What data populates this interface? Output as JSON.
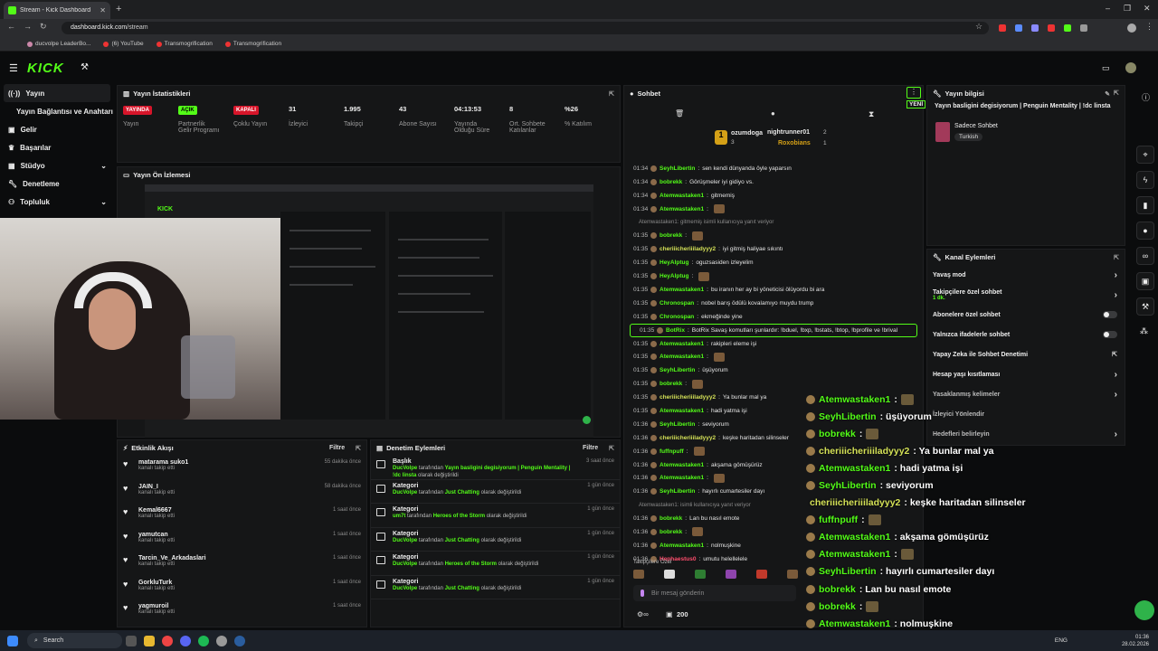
{
  "browser": {
    "tab_title": "Stream - Kick Dashboard",
    "url_host": "dashboard.kick.com",
    "url_path": "/stream",
    "bookmarks": [
      "ducvolpe LeaderBo...",
      "(6) YouTube",
      "Transmogrification",
      "Transmogrification"
    ]
  },
  "app": {
    "logo": "KICK"
  },
  "sidebar": {
    "items": [
      {
        "label": "Yayın",
        "icon": "broadcast-icon"
      },
      {
        "label": "Yayın Bağlantısı ve Anahtarı",
        "icon": ""
      },
      {
        "label": "Gelir",
        "icon": "wallet-icon"
      },
      {
        "label": "Başarılar",
        "icon": "trophy-icon"
      },
      {
        "label": "Stüdyo",
        "icon": "studio-icon"
      },
      {
        "label": "Denetleme",
        "icon": "wrench-icon"
      },
      {
        "label": "Topluluk",
        "icon": "people-icon"
      }
    ]
  },
  "stats_panel": {
    "title": "Yayın İstatistikleri",
    "items": [
      {
        "value": "YAYINDA",
        "label": "Yayın",
        "badge": "red"
      },
      {
        "value": "AÇIK",
        "label": "Partnerlik Gelir Programı",
        "badge": "green"
      },
      {
        "value": "KAPALI",
        "label": "Çoklu Yayın",
        "badge": "red"
      },
      {
        "value": "31",
        "label": "İzleyici"
      },
      {
        "value": "1.995",
        "label": "Takipçi"
      },
      {
        "value": "43",
        "label": "Abone Sayısı"
      },
      {
        "value": "04:13:53",
        "label": "Yayında Olduğu Süre"
      },
      {
        "value": "8",
        "label": "Ort. Sohbete Katılanlar"
      },
      {
        "value": "%26",
        "label": "% Katılım"
      }
    ]
  },
  "preview_panel": {
    "title": "Yayın Ön İzlemesi"
  },
  "activity_panel": {
    "title": "Etkinlik Akışı",
    "filter": "Filtre",
    "items": [
      {
        "name": "matarama suko1",
        "action": "kanalı takip etti",
        "time": "55 dakika önce"
      },
      {
        "name": "JAIN_I",
        "action": "kanalı takip etti",
        "time": "58 dakika önce"
      },
      {
        "name": "Kemal6667",
        "action": "kanalı takip etti",
        "time": "1 saat önce"
      },
      {
        "name": "yamutcan",
        "action": "kanalı takip etti",
        "time": "1 saat önce"
      },
      {
        "name": "Tarcin_Ve_Arkadaslari",
        "action": "kanalı takip etti",
        "time": "1 saat önce"
      },
      {
        "name": "GorkluTurk",
        "action": "kanalı takip etti",
        "time": "1 saat önce"
      },
      {
        "name": "yagmuroil",
        "action": "kanalı takip etti",
        "time": "1 saat önce"
      }
    ]
  },
  "moderation_panel": {
    "title": "Denetim Eylemleri",
    "filter": "Filtre",
    "items": [
      {
        "title": "Başlık",
        "user": "DucVolpe",
        "mid": " tarafından ",
        "target": "Yayın basligini degisiyorum | Penguin Mentality | !dc linsta",
        "suffix": " olarak değiştirildi",
        "time": "3 saat önce"
      },
      {
        "title": "Kategori",
        "user": "DucVolpe",
        "mid": " tarafından ",
        "target": "Just Chatting",
        "suffix": " olarak değiştirildi",
        "time": "1 gün önce"
      },
      {
        "title": "Kategori",
        "user": "um7t",
        "mid": " tarafından ",
        "target": "Heroes of the Storm",
        "suffix": " olarak değiştirildi",
        "time": "1 gün önce"
      },
      {
        "title": "Kategori",
        "user": "DucVolpe",
        "mid": " tarafından ",
        "target": "Just Chatting",
        "suffix": " olarak değiştirildi",
        "time": "1 gün önce"
      },
      {
        "title": "Kategori",
        "user": "DucVolpe",
        "mid": " tarafından ",
        "target": "Heroes of the Storm",
        "suffix": " olarak değiştirildi",
        "time": "1 gün önce"
      },
      {
        "title": "Kategori",
        "user": "DucVolpe",
        "mid": " tarafından ",
        "target": "Just Chatting",
        "suffix": " olarak değiştirildi",
        "time": "1 gün önce"
      }
    ]
  },
  "chat_panel": {
    "title": "Sohbet",
    "new_label": "YENİ",
    "leaders": [
      {
        "name": "ozumdoga",
        "count": "3"
      },
      {
        "name": "nightrunner01",
        "count": "2"
      },
      {
        "name": "Roxobians",
        "count": "1"
      }
    ],
    "messages": [
      {
        "time": "01:34",
        "user": "SeyhLibertin",
        "color": "#53fc18",
        "text": "sen kendi dünyanda öyle yaparsın"
      },
      {
        "time": "01:34",
        "user": "bobrekk",
        "color": "#53fc18",
        "text": "Görüşmeler iyi gidiyo vs."
      },
      {
        "time": "01:34",
        "user": "Atemwastaken1",
        "color": "#53fc18",
        "text": "gitmemiş"
      },
      {
        "time": "01:34",
        "user": "Atemwastaken1",
        "color": "#53fc18",
        "text": ""
      },
      {
        "time": "",
        "user": "",
        "color": "#888",
        "text": "Atemwastaken1: gitmemiş isimli kullanıcıya yanıt veriyor",
        "system": true
      },
      {
        "time": "01:35",
        "user": "bobrekk",
        "color": "#53fc18",
        "text": ""
      },
      {
        "time": "01:35",
        "user": "cheriiicheriiiladyyy2",
        "color": "#d4e157",
        "text": "iyi gitmiş haliyae sıkıntı"
      },
      {
        "time": "01:35",
        "user": "HeyAlptug",
        "color": "#53fc18",
        "text": "oguzsasiden izleyelim"
      },
      {
        "time": "01:35",
        "user": "HeyAlptug",
        "color": "#53fc18",
        "text": ""
      },
      {
        "time": "01:35",
        "user": "Atemwastaken1",
        "color": "#53fc18",
        "text": "bu iranın her ay bi yöneticisi ölüyordu bi ara"
      },
      {
        "time": "01:35",
        "user": "Chronospan",
        "color": "#53fc18",
        "text": "nobel barış ödülü kovalamıyo muydu trump"
      },
      {
        "time": "01:35",
        "user": "Chronospan",
        "color": "#53fc18",
        "text": "ekmeğinde yine"
      },
      {
        "time": "01:35",
        "user": "BotRix",
        "color": "#53fc18",
        "text": "BotRix Savaş komutları şunlardır: !bduel, !bxp, !bstats, !btop, !bprofile ve !brival",
        "highlight": true
      },
      {
        "time": "01:35",
        "user": "Atemwastaken1",
        "color": "#53fc18",
        "text": "rakipleri eleme işi"
      },
      {
        "time": "01:35",
        "user": "Atemwastaken1",
        "color": "#53fc18",
        "text": ""
      },
      {
        "time": "01:35",
        "user": "SeyhLibertin",
        "color": "#53fc18",
        "text": "üşüyorum"
      },
      {
        "time": "01:35",
        "user": "bobrekk",
        "color": "#53fc18",
        "text": ""
      },
      {
        "time": "01:35",
        "user": "cheriiicheriiiladyyy2",
        "color": "#d4e157",
        "text": "Ya bunlar mal ya"
      },
      {
        "time": "01:35",
        "user": "Atemwastaken1",
        "color": "#53fc18",
        "text": "hadi yatma işi"
      },
      {
        "time": "01:36",
        "user": "SeyhLibertin",
        "color": "#53fc18",
        "text": "seviyorum"
      },
      {
        "time": "01:36",
        "user": "cheriiicheriiiladyyy2",
        "color": "#d4e157",
        "text": "keşke haritadan silinseler"
      },
      {
        "time": "01:36",
        "user": "fuffnpuff",
        "color": "#53fc18",
        "text": ""
      },
      {
        "time": "01:36",
        "user": "Atemwastaken1",
        "color": "#53fc18",
        "text": "akşama gömüşürüz"
      },
      {
        "time": "01:36",
        "user": "Atemwastaken1",
        "color": "#53fc18",
        "text": ""
      },
      {
        "time": "01:36",
        "user": "SeyhLibertin",
        "color": "#53fc18",
        "text": "hayırlı cumartesiler dayı"
      },
      {
        "time": "",
        "user": "",
        "color": "#888",
        "text": "Atemwastaken1: isimli kullanıcıya yanıt veriyor",
        "system": true
      },
      {
        "time": "01:36",
        "user": "bobrekk",
        "color": "#53fc18",
        "text": "Lan bu nasıl emote"
      },
      {
        "time": "01:36",
        "user": "bobrekk",
        "color": "#53fc18",
        "text": ""
      },
      {
        "time": "01:36",
        "user": "Atemwastaken1",
        "color": "#53fc18",
        "text": "nolmuşkine"
      },
      {
        "time": "01:36",
        "user": "Hephaestus0",
        "color": "#ff4d6d",
        "text": "umutu helellelele"
      }
    ],
    "follower_label": "Takipçilere Özel",
    "input_placeholder": "Bir mesaj gönderin",
    "points": "200"
  },
  "stream_info_panel": {
    "title": "Yayın bilgisi",
    "stream_title": "Yayın basligini degisiyorum | Penguin Mentality | !dc linsta",
    "category": "Sadece Sohbet",
    "tag": "Turkish"
  },
  "channel_actions_panel": {
    "title": "Kanal Eylemleri",
    "items": [
      {
        "label": "Yavaş mod",
        "control": "arrow"
      },
      {
        "label": "Takipçilere özel sohbet",
        "sub": "1 dk.",
        "control": "arrow"
      },
      {
        "label": "Abonelere özel sohbet",
        "control": "toggle"
      },
      {
        "label": "Yalnızca ifadelerle sohbet",
        "control": "toggle"
      },
      {
        "label": "Yapay Zeka ile Sohbet Denetimi",
        "control": "link"
      },
      {
        "label": "Hesap yaşı kısıtlaması",
        "control": "arrow"
      },
      {
        "label": "Yasaklanmış kelimeler",
        "control": "arrow"
      },
      {
        "label": "İzleyici Yönlendir",
        "control": "none"
      },
      {
        "label": "Hedefleri belirleyin",
        "control": "arrow"
      }
    ]
  },
  "overlay_chat": [
    {
      "user": "Atemwastaken1",
      "color": "#53fc18",
      "text": " :"
    },
    {
      "user": "SeyhLibertin",
      "color": "#53fc18",
      "text": " : üşüyorum"
    },
    {
      "user": "bobrekk",
      "color": "#53fc18",
      "text": " :"
    },
    {
      "user": "cheriiicheriiiladyyy2",
      "color": "#d4e157",
      "text": " : Ya bunlar mal ya"
    },
    {
      "user": "Atemwastaken1",
      "color": "#53fc18",
      "text": " : hadi yatma işi"
    },
    {
      "user": "SeyhLibertin",
      "color": "#53fc18",
      "text": " : seviyorum"
    },
    {
      "user": "cheriiicheriiiladyyy2",
      "color": "#d4e157",
      "text": " : keşke haritadan silinseler"
    },
    {
      "user": "fuffnpuff",
      "color": "#53fc18",
      "text": " :"
    },
    {
      "user": "Atemwastaken1",
      "color": "#53fc18",
      "text": " : akşama gömüşürüz"
    },
    {
      "user": "Atemwastaken1",
      "color": "#53fc18",
      "text": " :"
    },
    {
      "user": "SeyhLibertin",
      "color": "#53fc18",
      "text": " : hayırlı cumartesiler dayı"
    },
    {
      "user": "bobrekk",
      "color": "#53fc18",
      "text": " : Lan bu nasıl emote"
    },
    {
      "user": "bobrekk",
      "color": "#53fc18",
      "text": " :"
    },
    {
      "user": "Atemwastaken1",
      "color": "#53fc18",
      "text": " : nolmuşkine"
    },
    {
      "user": "Hephaestus0",
      "color": "#ff4d6d",
      "text": " : umutu helellelele"
    }
  ],
  "taskbar": {
    "search": "Search",
    "lang": "ENG",
    "time": "01:36",
    "date": "28.02.2026"
  },
  "colors": {
    "accent": "#53fc18",
    "live": "#d7152a",
    "bg": "#0b0c0d",
    "panel": "#151617"
  }
}
